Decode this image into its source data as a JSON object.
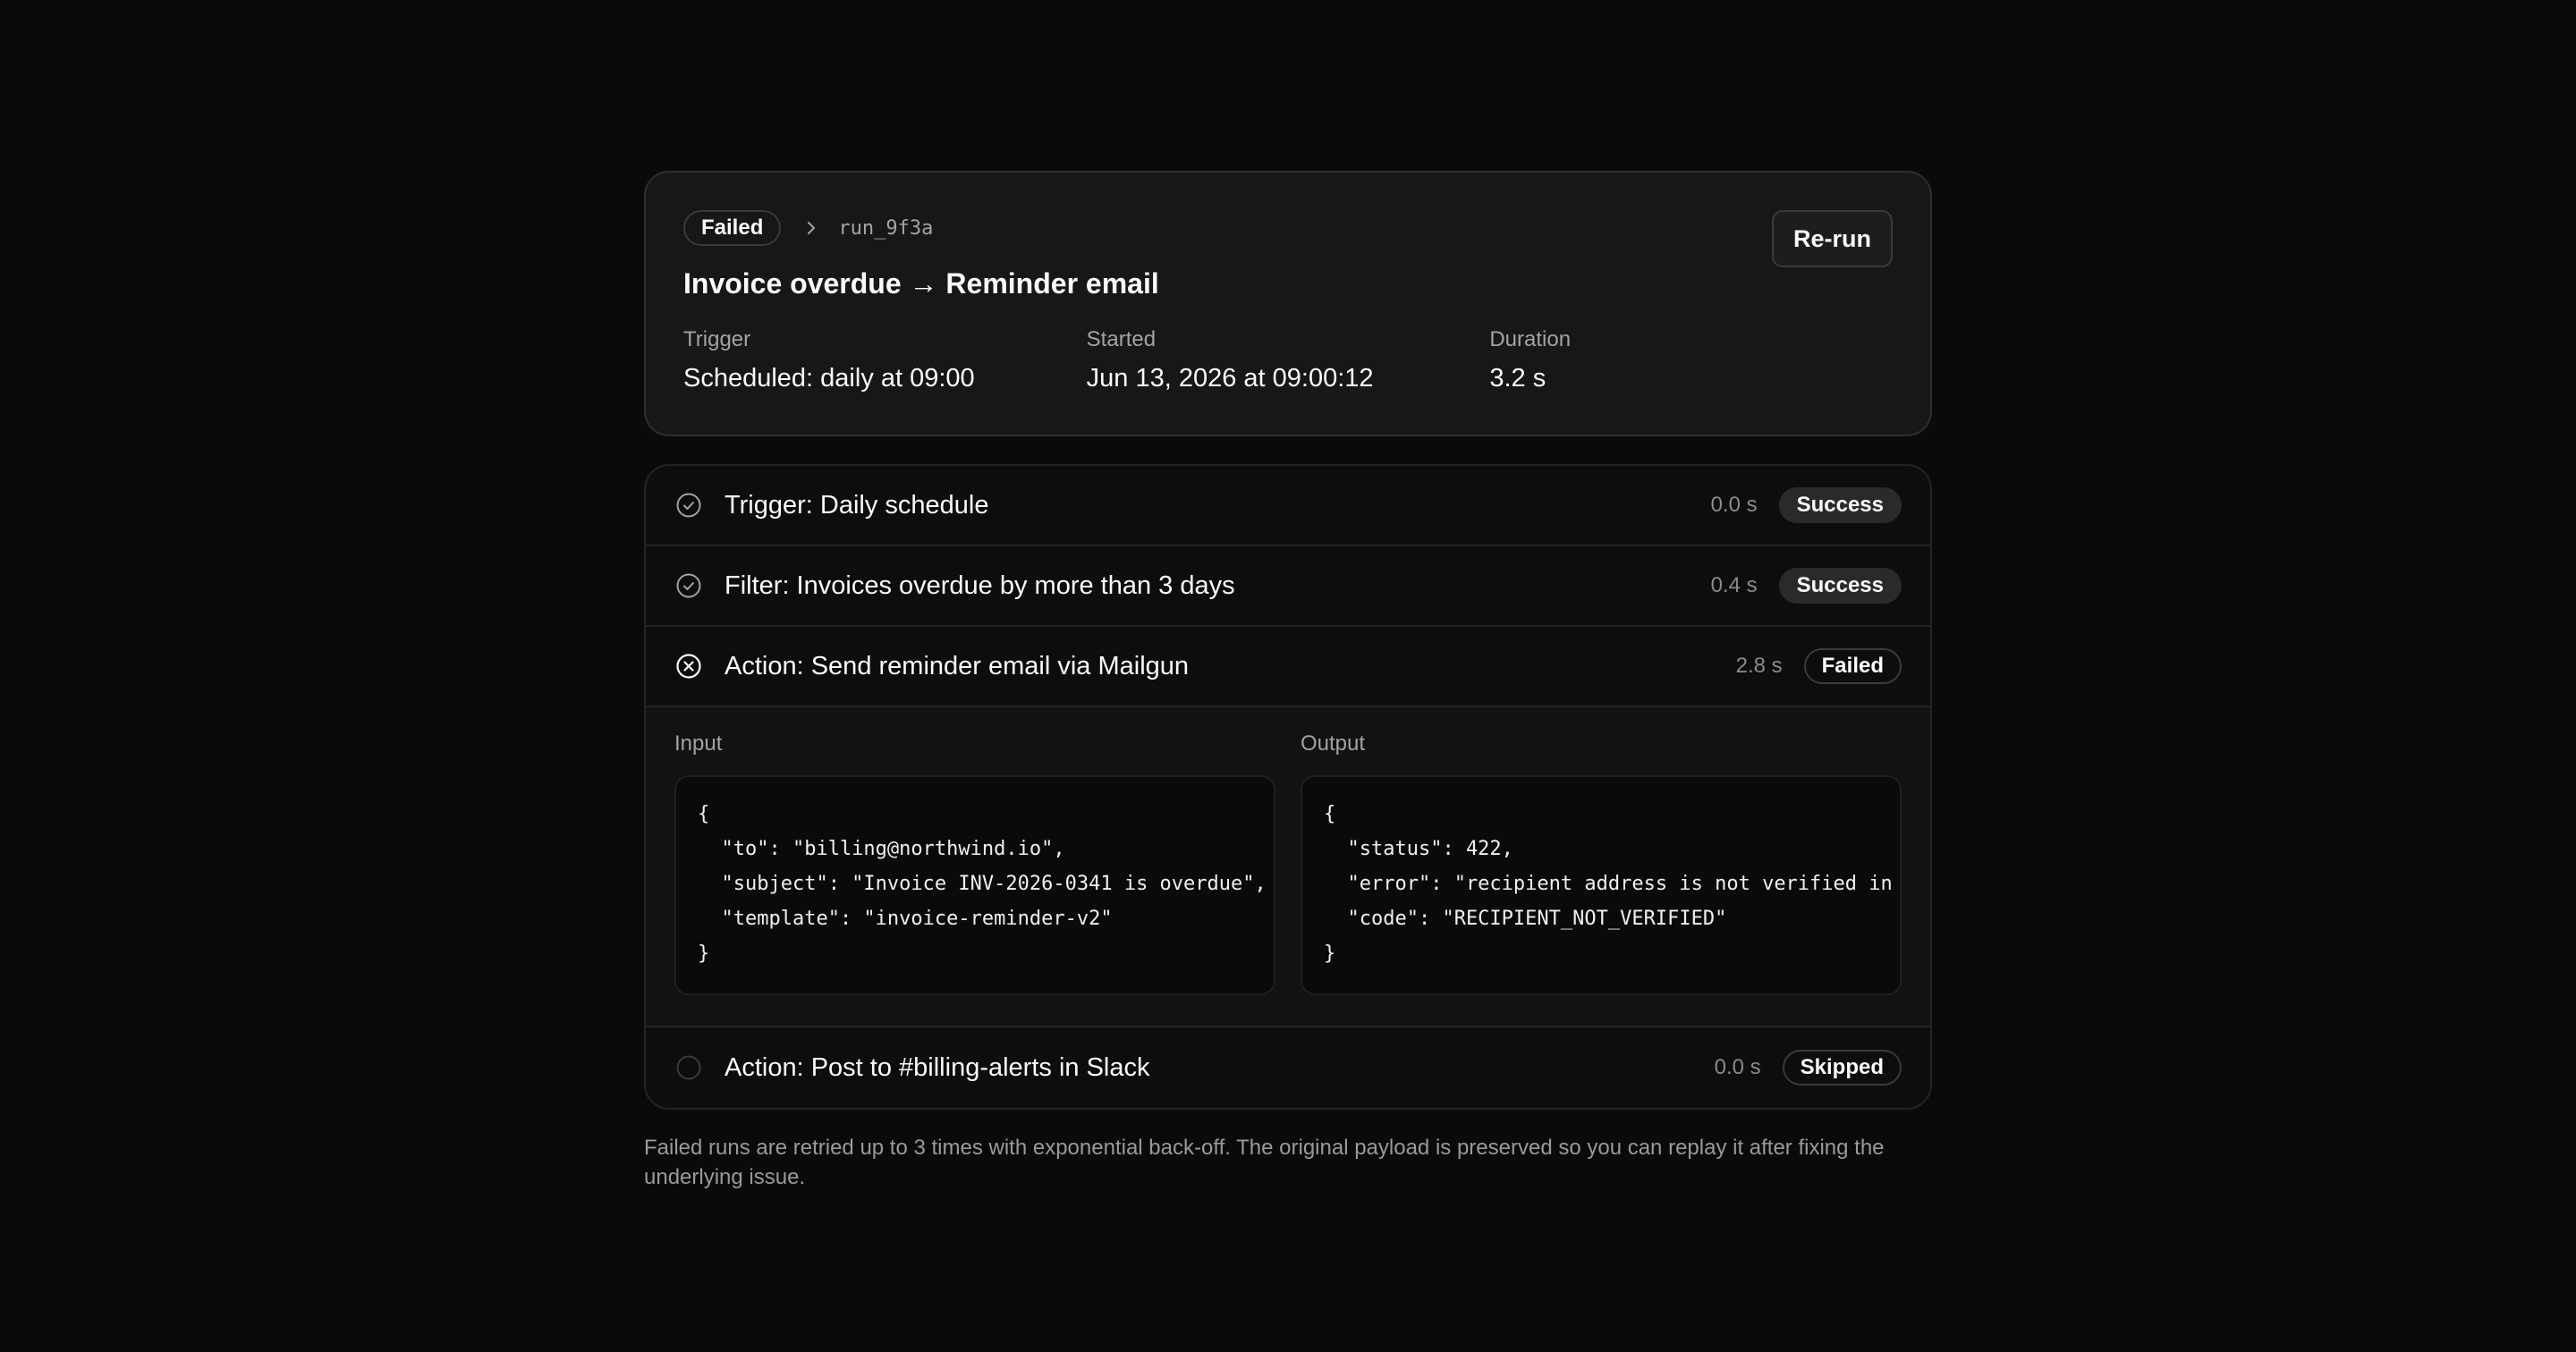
{
  "run": {
    "status": "Failed",
    "run_id": "run_9f3a",
    "title": "Invoice overdue → Reminder email",
    "rerun_label": "Re-run",
    "meta": [
      {
        "label": "Trigger",
        "value": "Scheduled: daily at 09:00"
      },
      {
        "label": "Started",
        "value": "Jun 13, 2026 at 09:00:12"
      },
      {
        "label": "Duration",
        "value": "3.2 s"
      }
    ]
  },
  "steps": [
    {
      "name": "Trigger: Daily schedule",
      "duration": "0.0 s",
      "status": "Success",
      "icon": "check-circle-icon"
    },
    {
      "name": "Filter: Invoices overdue by more than 3 days",
      "duration": "0.4 s",
      "status": "Success",
      "icon": "check-circle-icon"
    },
    {
      "name": "Action: Send reminder email via Mailgun",
      "duration": "2.8 s",
      "status": "Failed",
      "icon": "x-circle-icon"
    },
    {
      "name": "Action: Post to #billing-alerts in Slack",
      "duration": "0.0 s",
      "status": "Skipped",
      "icon": "empty-circle-icon"
    }
  ],
  "detail": {
    "input_label": "Input",
    "output_label": "Output",
    "input_lines": [
      "{",
      "  \"to\": \"billing@northwind.io\",",
      "  \"subject\": \"Invoice INV-2026-0341 is overdue\",",
      "  \"template\": \"invoice-reminder-v2\"",
      "}"
    ],
    "output_lines": [
      "{",
      "  \"status\": 422,",
      "  \"error\": \"recipient address is not verified in",
      "  \"code\": \"RECIPIENT_NOT_VERIFIED\"",
      "}"
    ]
  },
  "footnote": "Failed runs are retried up to 3 times with exponential back-off. The original payload is preserved so you can replay it after fixing the underlying issue."
}
